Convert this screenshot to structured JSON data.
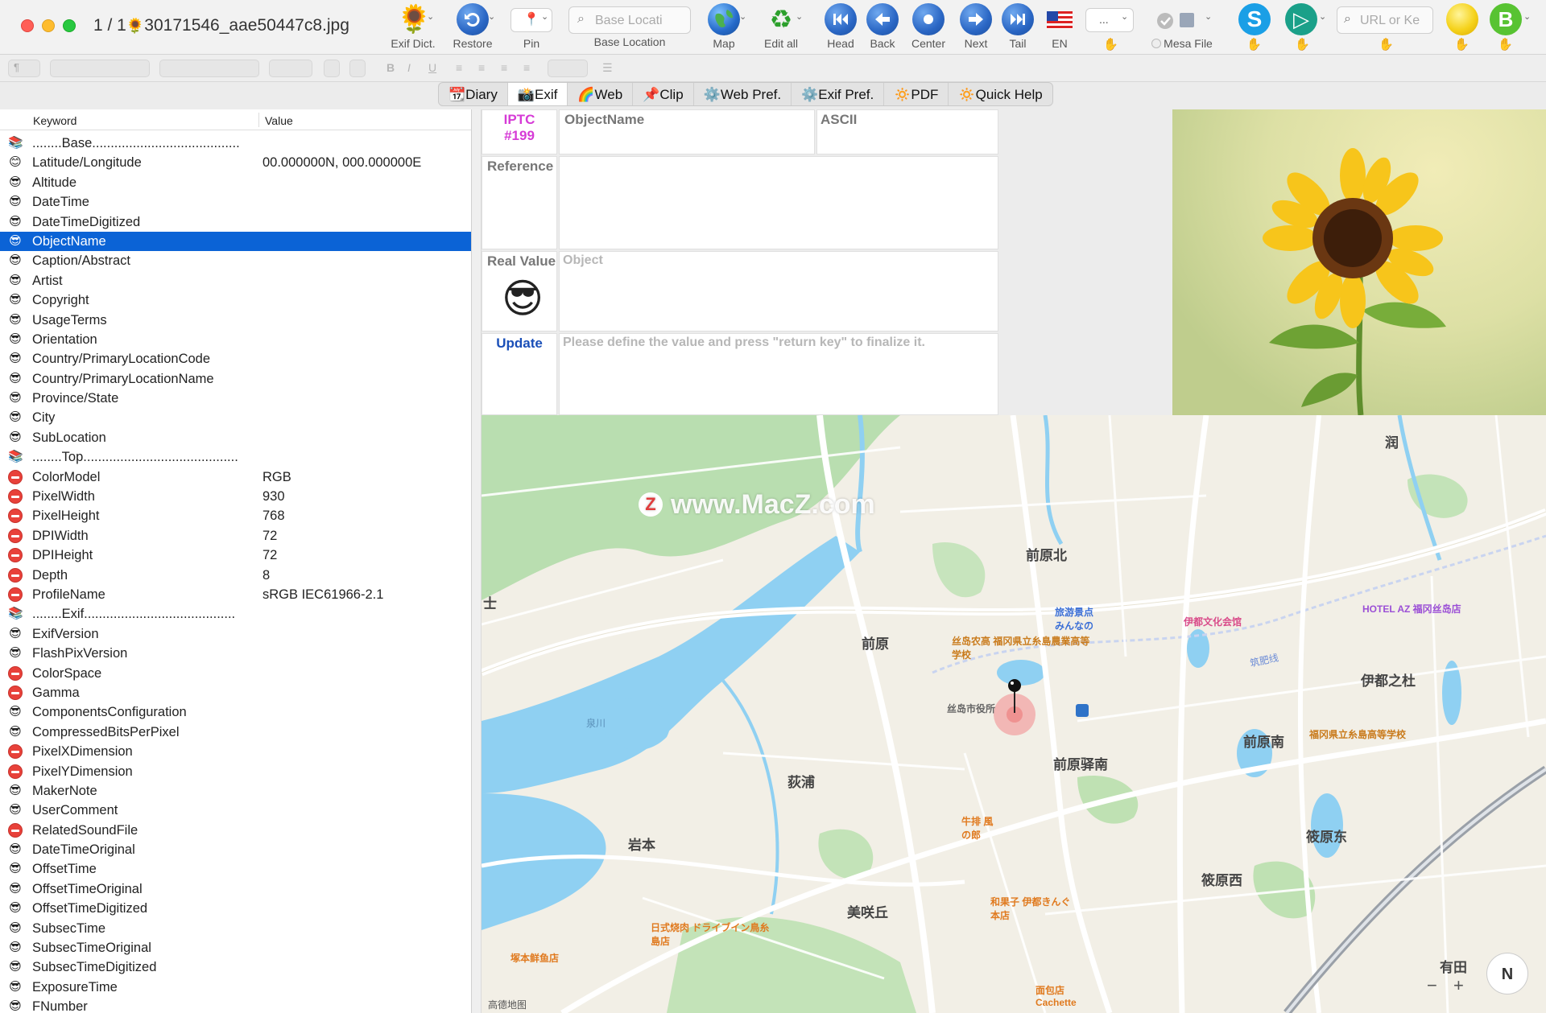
{
  "window": {
    "title_prefix": "1 / 1",
    "title_suffix": "30171546_aae50447c8.jpg"
  },
  "toolbar": {
    "exif_dict": "Exif Dict.",
    "restore": "Restore",
    "pin": "Pin",
    "search_placeholder": "Base Locati",
    "search_label": "Base Location",
    "map": "Map",
    "edit_all": "Edit all",
    "head": "Head",
    "back": "Back",
    "center": "Center",
    "next": "Next",
    "tail": "Tail",
    "lang": "EN",
    "ellipsis": "...",
    "mesa_file": "Mesa File",
    "url_placeholder": "URL or Ke"
  },
  "tabs": [
    {
      "icon": "📆",
      "label": "Diary"
    },
    {
      "icon": "📸",
      "label": "Exif"
    },
    {
      "icon": "🌈",
      "label": "Web"
    },
    {
      "icon": "📌",
      "label": "Clip"
    },
    {
      "icon": "⚙️",
      "label": "Web Pref."
    },
    {
      "icon": "⚙️",
      "label": "Exif Pref."
    },
    {
      "icon": "🔅",
      "label": "PDF"
    },
    {
      "icon": "🔅",
      "label": "Quick Help"
    }
  ],
  "active_tab": "Exif",
  "table": {
    "col_keyword": "Keyword",
    "col_value": "Value",
    "rows": [
      {
        "icon": "book",
        "key": "........Base........................................",
        "value": ""
      },
      {
        "icon": "smile",
        "key": "Latitude/Longitude",
        "value": "00.000000N, 000.000000E"
      },
      {
        "icon": "cool",
        "key": "Altitude",
        "value": ""
      },
      {
        "icon": "cool",
        "key": "DateTime",
        "value": ""
      },
      {
        "icon": "cool",
        "key": "DateTimeDigitized",
        "value": ""
      },
      {
        "icon": "cool",
        "key": "ObjectName",
        "value": "",
        "selected": true
      },
      {
        "icon": "cool",
        "key": "Caption/Abstract",
        "value": ""
      },
      {
        "icon": "cool",
        "key": "Artist",
        "value": ""
      },
      {
        "icon": "cool",
        "key": "Copyright",
        "value": ""
      },
      {
        "icon": "cool",
        "key": "UsageTerms",
        "value": ""
      },
      {
        "icon": "cool",
        "key": "Orientation",
        "value": ""
      },
      {
        "icon": "cool",
        "key": "Country/PrimaryLocationCode",
        "value": ""
      },
      {
        "icon": "cool",
        "key": "Country/PrimaryLocationName",
        "value": ""
      },
      {
        "icon": "cool",
        "key": "Province/State",
        "value": ""
      },
      {
        "icon": "cool",
        "key": "City",
        "value": ""
      },
      {
        "icon": "cool",
        "key": "SubLocation",
        "value": ""
      },
      {
        "icon": "book",
        "key": "........Top..........................................",
        "value": ""
      },
      {
        "icon": "stop",
        "key": "ColorModel",
        "value": "RGB"
      },
      {
        "icon": "stop",
        "key": "PixelWidth",
        "value": "930"
      },
      {
        "icon": "stop",
        "key": "PixelHeight",
        "value": "768"
      },
      {
        "icon": "stop",
        "key": "DPIWidth",
        "value": "72"
      },
      {
        "icon": "stop",
        "key": "DPIHeight",
        "value": "72"
      },
      {
        "icon": "stop",
        "key": "Depth",
        "value": "8"
      },
      {
        "icon": "stop",
        "key": "ProfileName",
        "value": "sRGB IEC61966-2.1"
      },
      {
        "icon": "book",
        "key": "........Exif.........................................",
        "value": ""
      },
      {
        "icon": "cool",
        "key": "ExifVersion",
        "value": ""
      },
      {
        "icon": "cool",
        "key": "FlashPixVersion",
        "value": ""
      },
      {
        "icon": "stop",
        "key": "ColorSpace",
        "value": ""
      },
      {
        "icon": "stop",
        "key": "Gamma",
        "value": ""
      },
      {
        "icon": "cool",
        "key": "ComponentsConfiguration",
        "value": ""
      },
      {
        "icon": "cool",
        "key": "CompressedBitsPerPixel",
        "value": ""
      },
      {
        "icon": "stop",
        "key": "PixelXDimension",
        "value": ""
      },
      {
        "icon": "stop",
        "key": "PixelYDimension",
        "value": ""
      },
      {
        "icon": "cool",
        "key": "MakerNote",
        "value": ""
      },
      {
        "icon": "cool",
        "key": "UserComment",
        "value": ""
      },
      {
        "icon": "stop",
        "key": "RelatedSoundFile",
        "value": ""
      },
      {
        "icon": "cool",
        "key": "DateTimeOriginal",
        "value": ""
      },
      {
        "icon": "cool",
        "key": "OffsetTime",
        "value": ""
      },
      {
        "icon": "cool",
        "key": "OffsetTimeOriginal",
        "value": ""
      },
      {
        "icon": "cool",
        "key": "OffsetTimeDigitized",
        "value": ""
      },
      {
        "icon": "cool",
        "key": "SubsecTime",
        "value": ""
      },
      {
        "icon": "cool",
        "key": "SubsecTimeOriginal",
        "value": ""
      },
      {
        "icon": "cool",
        "key": "SubsecTimeDigitized",
        "value": ""
      },
      {
        "icon": "cool",
        "key": "ExposureTime",
        "value": ""
      },
      {
        "icon": "cool",
        "key": "FNumber",
        "value": ""
      }
    ]
  },
  "detail": {
    "iptc_label": "IPTC",
    "iptc_id": "#199",
    "field_name": "ObjectName",
    "field_type": "ASCII",
    "reference_label": "Reference",
    "real_value_label": "Real Value",
    "real_value_placeholder": "Object",
    "update_label": "Update",
    "update_hint": "Please define the value and  press \"return key\" to finalize it."
  },
  "map": {
    "watermark": "www.MacZ.com",
    "watermark_letter": "Z",
    "copyright": "高德地图",
    "labels": [
      "前原北",
      "前原",
      "伊都之杜",
      "前原南",
      "前原驿南",
      "荻浦",
      "岩本",
      "筱原东",
      "筱原西",
      "美咲丘",
      "有田",
      "润",
      "士"
    ],
    "pois": [
      {
        "text": "旅游景点 みんなの",
        "color": "#3b6fd6"
      },
      {
        "text": "伊都文化会馆",
        "color": "#d94c8a"
      },
      {
        "text": "HOTEL AZ 福冈丝岛店",
        "color": "#9b4fd6"
      },
      {
        "text": "丝岛农高 福冈県立糸島農業高等学校",
        "color": "#c97b1c"
      },
      {
        "text": "丝岛市役所",
        "color": "#666666"
      },
      {
        "text": "福冈県立糸島高等学校",
        "color": "#c97b1c"
      },
      {
        "text": "牛排 風の郎",
        "color": "#e07a1f"
      },
      {
        "text": "和果子 伊都きんぐ本店",
        "color": "#e07a1f"
      },
      {
        "text": "日式烧肉 ドライブイン鳥糸島店",
        "color": "#e07a1f"
      },
      {
        "text": "塚本鲜鱼店",
        "color": "#e07a1f"
      },
      {
        "text": "面包店 Cachette",
        "color": "#e07a1f"
      }
    ],
    "river_label": "泉川",
    "rail_label": "筑肥线",
    "zoom_out": "−",
    "zoom_in": "+",
    "compass": "N"
  },
  "colors": {
    "selection": "#0b63d6",
    "water": "#8fd0f2",
    "park": "#b9deb0"
  }
}
